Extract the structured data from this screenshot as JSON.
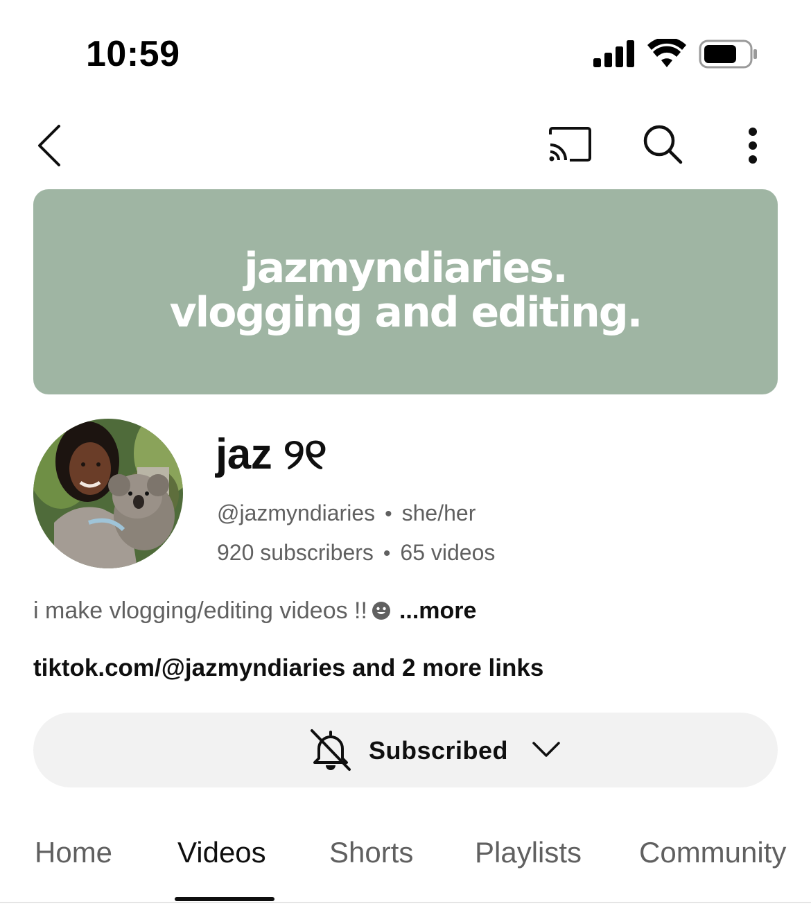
{
  "status_bar": {
    "time": "10:59",
    "signal_icon": "cellular-signal-icon",
    "wifi_icon": "wifi-icon",
    "battery_icon": "battery-icon"
  },
  "app_bar": {
    "back_icon": "chevron-left-icon",
    "cast_icon": "cast-icon",
    "search_icon": "search-icon",
    "more_icon": "more-vertical-icon"
  },
  "banner": {
    "line1": "jazmyndiaries.",
    "line2": "vlogging and editing.",
    "background": "#9fb5a3"
  },
  "channel": {
    "name": "jaz ୨୧",
    "handle": "@jazmyndiaries",
    "pronouns": "she/her",
    "subscribers": "920 subscribers",
    "videos": "65 videos",
    "separator": "•",
    "description": "i make vlogging/editing videos !!",
    "description_emoji": "smiley-face-icon",
    "more_label": "...more",
    "links_text": "tiktok.com/@jazmyndiaries and 2 more links"
  },
  "subscribe": {
    "label": "Subscribed",
    "bell_icon": "bell-off-icon",
    "chevron_icon": "chevron-down-icon"
  },
  "tabs": [
    {
      "label": "Home",
      "active": false
    },
    {
      "label": "Videos",
      "active": true
    },
    {
      "label": "Shorts",
      "active": false
    },
    {
      "label": "Playlists",
      "active": false
    },
    {
      "label": "Community",
      "active": false
    }
  ]
}
